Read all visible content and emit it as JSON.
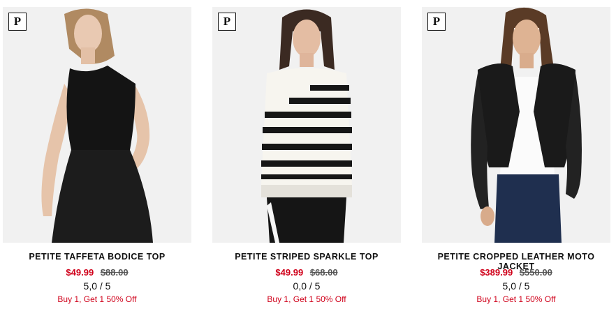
{
  "products": [
    {
      "badge": "P",
      "name": "PETITE TAFFETA BODICE TOP",
      "sale_price": "$49.99",
      "original_price": "$88.00",
      "rating": "5,0 / 5",
      "promo": "Buy 1, Get 1 50% Off"
    },
    {
      "badge": "P",
      "name": "PETITE STRIPED SPARKLE TOP",
      "sale_price": "$49.99",
      "original_price": "$68.00",
      "rating": "0,0 / 5",
      "promo": "Buy 1, Get 1 50% Off"
    },
    {
      "badge": "P",
      "name": "PETITE CROPPED LEATHER MOTO JACKET",
      "sale_price": "$389.99",
      "original_price": "$550.00",
      "rating": "5,0 / 5",
      "promo": "Buy 1, Get 1 50% Off"
    }
  ],
  "colors": {
    "sale_red": "#d0021b",
    "photo_bg": "#efefef",
    "text": "#111111"
  }
}
